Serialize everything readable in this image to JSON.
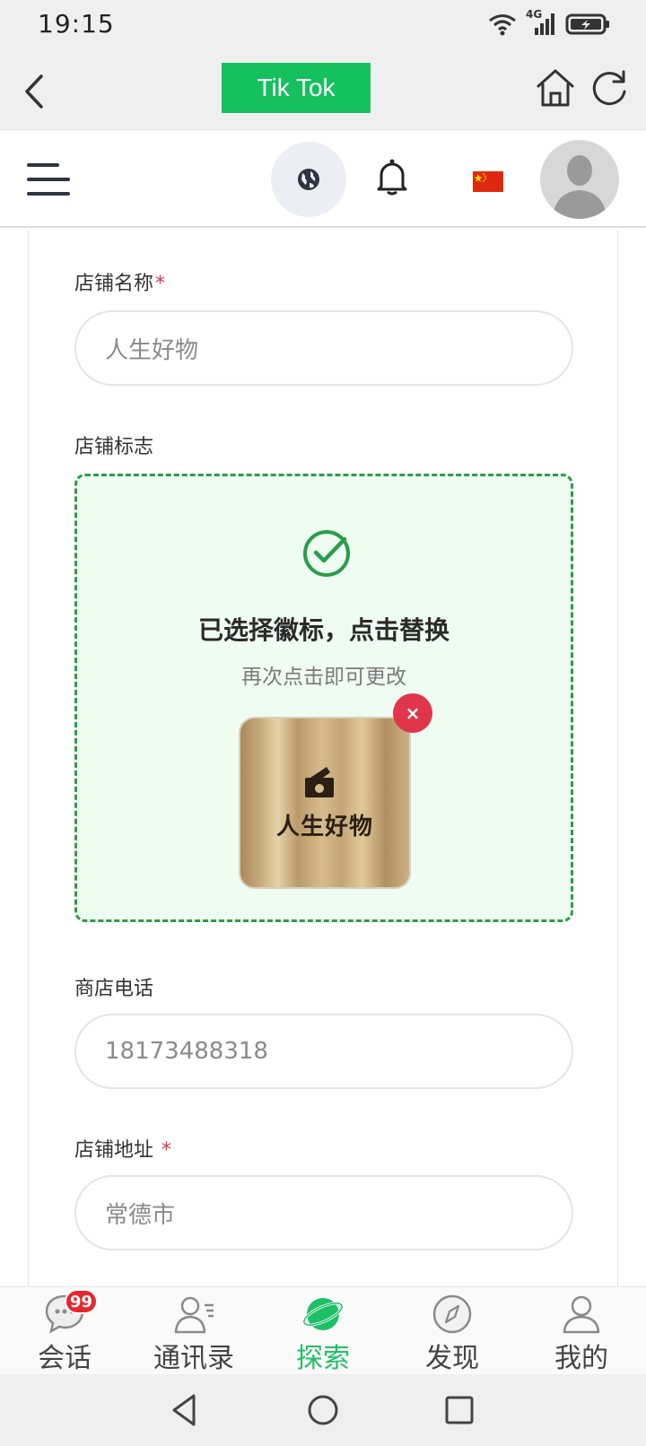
{
  "status_bar": {
    "time": "19:15",
    "network": "4G"
  },
  "app_bar": {
    "title": "Tik Tok"
  },
  "form": {
    "shop_name_label": "店铺名称",
    "shop_name_required": "*",
    "shop_name_value": "人生好物",
    "logo_label": "店铺标志",
    "logo_title": "已选择徽标，点击替换",
    "logo_subtitle": "再次点击即可更改",
    "logo_image_text": "人生好物",
    "remove_label": "×",
    "phone_label": "商店电话",
    "phone_value": "18173488318",
    "address_label": "店铺地址",
    "address_required": "*",
    "address_value": "常德市"
  },
  "tabs": [
    {
      "label": "会话",
      "icon": "chat-icon",
      "badge": "99"
    },
    {
      "label": "通讯录",
      "icon": "contacts-icon"
    },
    {
      "label": "探索",
      "icon": "planet-icon",
      "active": true
    },
    {
      "label": "发现",
      "icon": "compass-icon"
    },
    {
      "label": "我的",
      "icon": "profile-icon"
    }
  ],
  "colors": {
    "accent": "#15c05e",
    "required": "#d9354d",
    "upload_border": "#2a9d48",
    "badge": "#e8262f"
  }
}
